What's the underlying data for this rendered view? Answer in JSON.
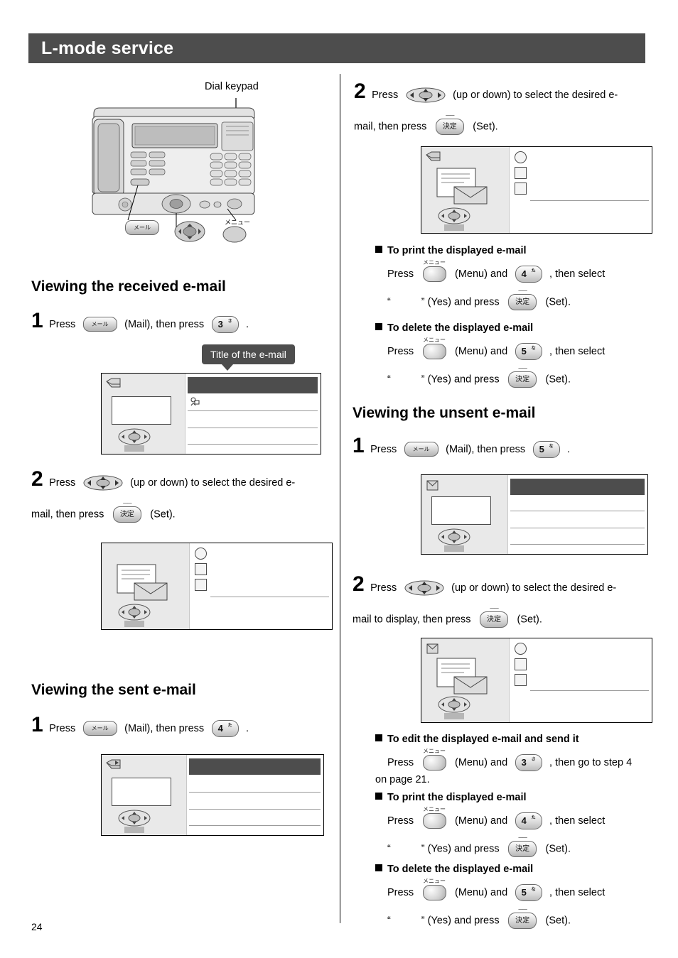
{
  "header": {
    "title": "L-mode service"
  },
  "page_number": "24",
  "figure": {
    "label_dial_keypad": "Dial keypad",
    "label_mail_key": "メール",
    "label_menu_key": "メニュー"
  },
  "keys": {
    "mail": "メール",
    "set": "決定",
    "menu_label": "メニュー",
    "set_tick": "一一",
    "num3": "3",
    "num3_sub": "さ",
    "num4": "4",
    "num4_sub": "た",
    "num5": "5",
    "num5_sub": "な"
  },
  "sections": {
    "received": {
      "heading": "Viewing the received e-mail",
      "step1": {
        "num": "1",
        "press": "Press",
        "mail_paren": "(Mail), then press",
        "period": "."
      },
      "callout": "Title of the e-mail",
      "step2": {
        "num": "2",
        "press": "Press",
        "updown": "(up or down) to select the desired e-",
        "line2": "mail, then press",
        "set_paren": "(Set)."
      }
    },
    "sent": {
      "heading": "Viewing the sent e-mail",
      "step1": {
        "num": "1",
        "press": "Press",
        "mail_paren": "(Mail), then press",
        "period": "."
      },
      "step2": {
        "num": "2",
        "press": "Press",
        "updown": "(up or down) to select the desired e-",
        "line2": "mail, then press",
        "set_paren": "(Set)."
      },
      "print": {
        "title": "To print the displayed e-mail",
        "press": "Press",
        "menu_and": "(Menu) and",
        "then_select": ", then select",
        "quote_open": "“",
        "quote_close": "” (Yes) and press",
        "set_paren": "(Set)."
      },
      "delete": {
        "title": "To delete the displayed e-mail",
        "press": "Press",
        "menu_and": "(Menu) and",
        "then_select": ", then select",
        "quote_open": "“",
        "quote_close": "” (Yes) and press",
        "set_paren": "(Set)."
      }
    },
    "unsent": {
      "heading": "Viewing the unsent e-mail",
      "step1": {
        "num": "1",
        "press": "Press",
        "mail_paren": "(Mail), then press",
        "period": "."
      },
      "step2": {
        "num": "2",
        "press": "Press",
        "updown": "(up or down) to select the desired e-",
        "line2": "mail to display, then press",
        "set_paren": "(Set)."
      },
      "edit": {
        "title": "To edit the displayed e-mail and send it",
        "press": "Press",
        "menu_and": "(Menu) and",
        "then_goto": ", then go to step 4",
        "line2": "on page 21."
      },
      "print": {
        "title": "To print the displayed e-mail",
        "press": "Press",
        "menu_and": "(Menu) and",
        "then_select": ", then select",
        "quote_open": "“",
        "quote_close": "” (Yes) and press",
        "set_paren": "(Set)."
      },
      "delete": {
        "title": "To delete the displayed e-mail",
        "press": "Press",
        "menu_and": "(Menu) and",
        "then_select": ", then select",
        "quote_open": "“",
        "quote_close": "” (Yes) and press",
        "set_paren": "(Set)."
      }
    }
  },
  "colors": {
    "header_bg": "#4d4d4d",
    "lcd_left_bg": "#e9e9e9",
    "lcd_titlebar": "#4d4d4d"
  }
}
